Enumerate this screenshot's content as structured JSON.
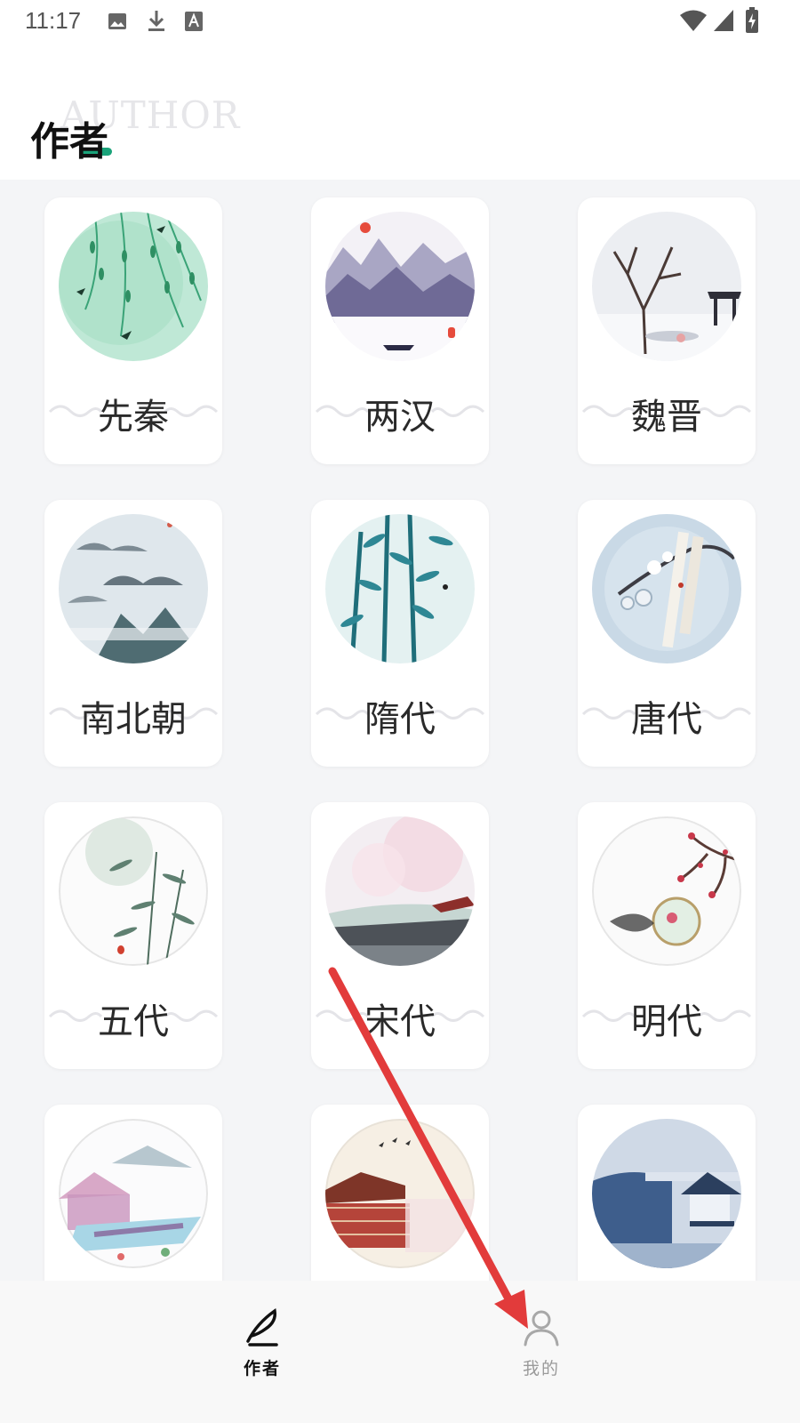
{
  "status_bar": {
    "time": "11:17",
    "left_icons": [
      "image-icon",
      "download-icon",
      "font-icon"
    ],
    "right_icons": [
      "wifi-icon",
      "signal-icon",
      "battery-charging-icon"
    ]
  },
  "header": {
    "title": "作者",
    "subtitle_watermark": "AUTHOR",
    "accent_color": "#1aa37a"
  },
  "dynasties": [
    {
      "label": "先秦",
      "art": "willow-swallows"
    },
    {
      "label": "两汉",
      "art": "ink-mountains-boat"
    },
    {
      "label": "魏晋",
      "art": "snowy-tree-pavilion"
    },
    {
      "label": "南北朝",
      "art": "misty-peaks"
    },
    {
      "label": "隋代",
      "art": "bamboo"
    },
    {
      "label": "唐代",
      "art": "plum-blossom-scroll"
    },
    {
      "label": "五代",
      "art": "moon-bamboo"
    },
    {
      "label": "宋代",
      "art": "cherry-palace-roof"
    },
    {
      "label": "明代",
      "art": "plum-fan"
    },
    {
      "label": "",
      "art": "garden-pavilion"
    },
    {
      "label": "",
      "art": "red-palace-birds"
    },
    {
      "label": "",
      "art": "snowy-pavilion-lake"
    }
  ],
  "bottom_nav": {
    "items": [
      {
        "label": "作者",
        "icon": "quill-pen-icon",
        "active": true
      },
      {
        "label": "我的",
        "icon": "user-icon",
        "active": false
      }
    ]
  },
  "annotation": {
    "type": "arrow",
    "color": "#e23b3b",
    "points_to": "我的"
  }
}
